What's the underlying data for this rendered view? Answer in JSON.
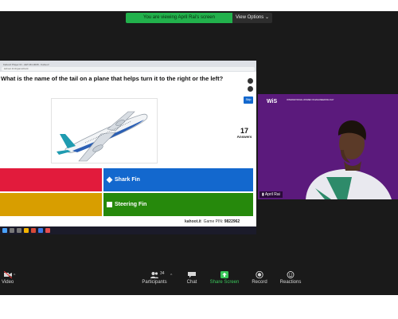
{
  "banner": {
    "viewing": "You are viewing April Rai's screen",
    "view_options": "View Options"
  },
  "browser": {
    "tabs": "Kahoot!   Player ID - AET-M4-0008 - Kahoot!",
    "url": "kahoot.it/v2/gameblock"
  },
  "quiz": {
    "question": "What is the name of the tail on a plane that helps turn it to the right or the left?",
    "skip_label": "Skip",
    "answers_count": "17",
    "answers_label": "Answers",
    "answers": [
      {
        "color": "red",
        "label": ""
      },
      {
        "color": "blue",
        "label": "Shark Fin",
        "symbol": "diamond"
      },
      {
        "color": "yellow",
        "label": ""
      },
      {
        "color": "green",
        "label": "Steering Fin",
        "symbol": "square"
      }
    ],
    "footer_site": "kahoot.it",
    "footer_pin_label": "Game PIN:",
    "footer_pin": "9822962"
  },
  "camera": {
    "name": "April Rai",
    "logo": "WiS",
    "logo_text": "INTERNATIONAL WOMEN IN ENGINEERING DAY"
  },
  "toolbar": {
    "video": "Video",
    "participants": "Participants",
    "participants_count": "34",
    "chat": "Chat",
    "share_screen": "Share Screen",
    "record": "Record",
    "reactions": "Reactions"
  },
  "colors": {
    "red": "#e21b3c",
    "blue": "#1368ce",
    "yellow": "#d89e00",
    "green": "#26890c",
    "zoom_green": "#22b14c",
    "camera_bg": "#5b1a7c"
  }
}
